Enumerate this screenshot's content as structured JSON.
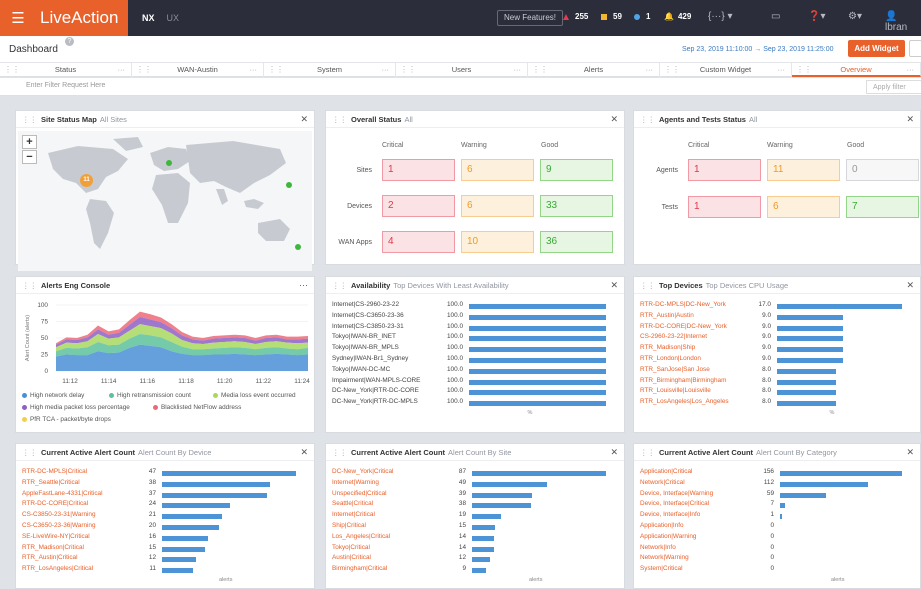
{
  "app": {
    "logo": "LiveAction",
    "mode_active": "NX",
    "mode_other": "UX",
    "new_features": "New Features!",
    "counts": [
      {
        "value": "255",
        "icon": "critical-triangle"
      },
      {
        "value": "59",
        "icon": "warning-square"
      },
      {
        "value": "1",
        "icon": "info-circle"
      },
      {
        "value": "429",
        "icon": "bell"
      }
    ]
  },
  "page": {
    "title": "Dashboard",
    "date_range": "Sep 23, 2019 11:10:00 → Sep 23, 2019 11:25:00",
    "add_widget": "Add Widget"
  },
  "tabs": [
    {
      "label": "Status"
    },
    {
      "label": "WAN-Austin"
    },
    {
      "label": "System"
    },
    {
      "label": "Users"
    },
    {
      "label": "Alerts"
    },
    {
      "label": "Custom Widget"
    },
    {
      "label": "Overview",
      "active": true
    }
  ],
  "filter": {
    "placeholder": "Enter Filter Request Here",
    "apply": "Apply filter"
  },
  "site_map": {
    "title": "Site Status Map",
    "subtitle": "All Sites",
    "cluster": "11",
    "zoom_in": "+",
    "zoom_out": "−"
  },
  "overall": {
    "title": "Overall Status",
    "subtitle": "All",
    "cols": [
      "Critical",
      "Warning",
      "Good"
    ],
    "rows": [
      {
        "label": "Sites",
        "values": [
          "1",
          "6",
          "9"
        ]
      },
      {
        "label": "Devices",
        "values": [
          "2",
          "6",
          "33"
        ]
      },
      {
        "label": "WAN Apps",
        "values": [
          "4",
          "10",
          "36"
        ]
      }
    ]
  },
  "agents": {
    "title": "Agents and Tests Status",
    "subtitle": "All",
    "cols": [
      "Critical",
      "Warning",
      "Good"
    ],
    "rows": [
      {
        "label": "Agents",
        "values": [
          "1",
          "11",
          "0"
        ]
      },
      {
        "label": "Tests",
        "values": [
          "1",
          "6",
          "7"
        ]
      }
    ]
  },
  "alerts_eng": {
    "title": "Alerts Eng Console",
    "ylabel": "Alert Count (alerts)",
    "legend": [
      "High network delay",
      "High retransmission count",
      "Media loss event occurred",
      "High media packet loss percentage",
      "Blacklisted NetFlow address",
      "PfR TCA - packet/byte drops"
    ],
    "colors": [
      "#4a8fd6",
      "#5dc19b",
      "#a8d85e",
      "#8e5fc4",
      "#ec6a78",
      "#f2d04e"
    ]
  },
  "availability": {
    "title": "Availability",
    "subtitle": "Top Devices With Least Availability",
    "unit": "%"
  },
  "top_devices": {
    "title": "Top Devices",
    "subtitle": "Top Devices CPU Usage",
    "unit": "%"
  },
  "alert_device": {
    "title": "Current Active Alert Count",
    "subtitle": "Alert Count By Device",
    "unit": "alerts"
  },
  "alert_site": {
    "title": "Current Active Alert Count",
    "subtitle": "Alert Count By Site",
    "unit": "alerts"
  },
  "alert_category": {
    "title": "Current Active Alert Count",
    "subtitle": "Alert Count By Category",
    "unit": "alerts"
  },
  "chart_data": [
    {
      "type": "area",
      "title": "Alerts Eng Console",
      "ylabel": "Alert Count (alerts)",
      "ylim": [
        0,
        100
      ],
      "yticks": [
        "100",
        "75",
        "50",
        "25",
        "0"
      ],
      "xticks": [
        "11:12",
        "11:14",
        "11:16",
        "11:18",
        "11:20",
        "11:22",
        "11:24"
      ],
      "series": [
        {
          "name": "High network delay",
          "values": [
            22,
            25,
            24,
            24,
            30,
            27,
            28,
            35,
            40,
            38,
            36,
            30,
            26,
            24,
            24,
            25,
            25,
            26,
            25,
            24,
            25,
            26,
            25,
            24,
            25
          ]
        },
        {
          "name": "High retransmission count",
          "values": [
            8,
            10,
            10,
            12,
            14,
            12,
            12,
            14,
            16,
            16,
            15,
            14,
            11,
            9,
            9,
            9,
            10,
            10,
            10,
            9,
            10,
            10,
            9,
            9,
            10
          ]
        },
        {
          "name": "Media loss event occurred",
          "values": [
            6,
            8,
            8,
            9,
            12,
            10,
            11,
            12,
            15,
            14,
            14,
            13,
            10,
            9,
            8,
            9,
            9,
            9,
            9,
            8,
            9,
            9,
            9,
            9,
            8
          ]
        },
        {
          "name": "High media packet loss percentage",
          "values": [
            4,
            5,
            5,
            6,
            7,
            6,
            7,
            9,
            11,
            10,
            9,
            8,
            7,
            6,
            5,
            6,
            6,
            6,
            6,
            5,
            6,
            6,
            5,
            6,
            6
          ]
        },
        {
          "name": "Blacklisted NetFlow address",
          "values": [
            2,
            3,
            3,
            4,
            6,
            5,
            5,
            7,
            8,
            8,
            7,
            6,
            5,
            4,
            4,
            4,
            4,
            4,
            4,
            4,
            4,
            4,
            4,
            4,
            4
          ]
        },
        {
          "name": "PfR TCA - packet/byte drops",
          "values": [
            0,
            0,
            0,
            0,
            0,
            0,
            0,
            0,
            0,
            0,
            0,
            0,
            0,
            0,
            0,
            0,
            0,
            0,
            0,
            0,
            0,
            0,
            0,
            0,
            0
          ]
        }
      ]
    },
    {
      "type": "bar",
      "title": "Availability",
      "subtitle": "Top Devices With Least Availability",
      "categories": [
        "Internet|CS-2960-23-22",
        "Internet|CS-C3650-23-36",
        "Internet|CS-C3850-23-31",
        "Tokyo|IWAN-BR_INET",
        "Tokyo|IWAN-BR_MPLS",
        "Sydney|IWAN-Br1_Sydney",
        "Tokyo|IWAN-DC-MC",
        "Impairment|WAN-MPLS-CORE",
        "DC-New_York|RTR-DC-CORE",
        "DC-New_York|RTR-DC-MPLS"
      ],
      "values": [
        100.0,
        100.0,
        100.0,
        100.0,
        100.0,
        100.0,
        100.0,
        100.0,
        100.0,
        100.0
      ],
      "labels": [
        "100.0",
        "100.0",
        "100.0",
        "100.0",
        "100.0",
        "100.0",
        "100.0",
        "100.0",
        "100.0",
        "100.0"
      ],
      "xlim": [
        0,
        100
      ],
      "xlabel": "%"
    },
    {
      "type": "bar",
      "title": "Top Devices",
      "subtitle": "Top Devices CPU Usage",
      "categories": [
        "RTR-DC-MPLS|DC-New_York",
        "RTR_Austin|Austin",
        "RTR-DC-CORE|DC-New_York",
        "CS-2960-23-22|Internet",
        "RTR_Madison|Ship",
        "RTR_London|London",
        "RTR_SanJose|San Jose",
        "RTR_Birmingham|Birmingham",
        "RTR_Louisville|Louisville",
        "RTR_LosAngeles|Los_Angeles"
      ],
      "values": [
        17.0,
        9.0,
        9.0,
        9.0,
        9.0,
        9.0,
        8.0,
        8.0,
        8.0,
        8.0
      ],
      "labels": [
        "17.0",
        "9.0",
        "9.0",
        "9.0",
        "9.0",
        "9.0",
        "8.0",
        "8.0",
        "8.0",
        "8.0"
      ],
      "xlim": [
        0,
        17
      ],
      "xlabel": "%"
    },
    {
      "type": "bar",
      "title": "Current Active Alert Count",
      "subtitle": "Alert Count By Device",
      "categories": [
        "RTR-DC-MPLS|Critical",
        "RTR_Seattle|Critical",
        "AppleFastLane-4331|Critical",
        "RTR-DC-CORE|Critical",
        "CS-C3850-23-31|Warning",
        "CS-C3650-23-36|Warning",
        "SE-LiveWire-NY|Critical",
        "RTR_Madison|Critical",
        "RTR_Austin|Critical",
        "RTR_LosAngeles|Critical"
      ],
      "values": [
        47,
        38,
        37,
        24,
        21,
        20,
        16,
        15,
        12,
        11
      ],
      "labels": [
        "47",
        "38",
        "37",
        "24",
        "21",
        "20",
        "16",
        "15",
        "12",
        "11"
      ],
      "xlim": [
        0,
        47
      ],
      "xlabel": "alerts"
    },
    {
      "type": "bar",
      "title": "Current Active Alert Count",
      "subtitle": "Alert Count By Site",
      "categories": [
        "DC-New_York|Critical",
        "Internet|Warning",
        "Unspecified|Critical",
        "Seattle|Critical",
        "Internet|Critical",
        "Ship|Critical",
        "Los_Angeles|Critical",
        "Tokyo|Critical",
        "Austin|Critical",
        "Birmingham|Critical"
      ],
      "values": [
        87,
        49,
        39,
        38,
        19,
        15,
        14,
        14,
        12,
        9
      ],
      "labels": [
        "87",
        "49",
        "39",
        "38",
        "19",
        "15",
        "14",
        "14",
        "12",
        "9"
      ],
      "xlim": [
        0,
        87
      ],
      "xlabel": "alerts"
    },
    {
      "type": "bar",
      "title": "Current Active Alert Count",
      "subtitle": "Alert Count By Category",
      "categories": [
        "Application|Critical",
        "Network|Critical",
        "Device, Interface|Warning",
        "Device, Interface|Critical",
        "Device, Interface|Info",
        "Application|Info",
        "Application|Warning",
        "Network|Info",
        "Network|Warning",
        "System|Critical"
      ],
      "values": [
        156,
        112,
        59,
        7,
        1,
        0,
        0,
        0,
        0,
        0
      ],
      "labels": [
        "156",
        "112",
        "59",
        "7",
        "1",
        "0",
        "0",
        "0",
        "0",
        "0"
      ],
      "xlim": [
        0,
        156
      ],
      "xlabel": "alerts"
    }
  ]
}
